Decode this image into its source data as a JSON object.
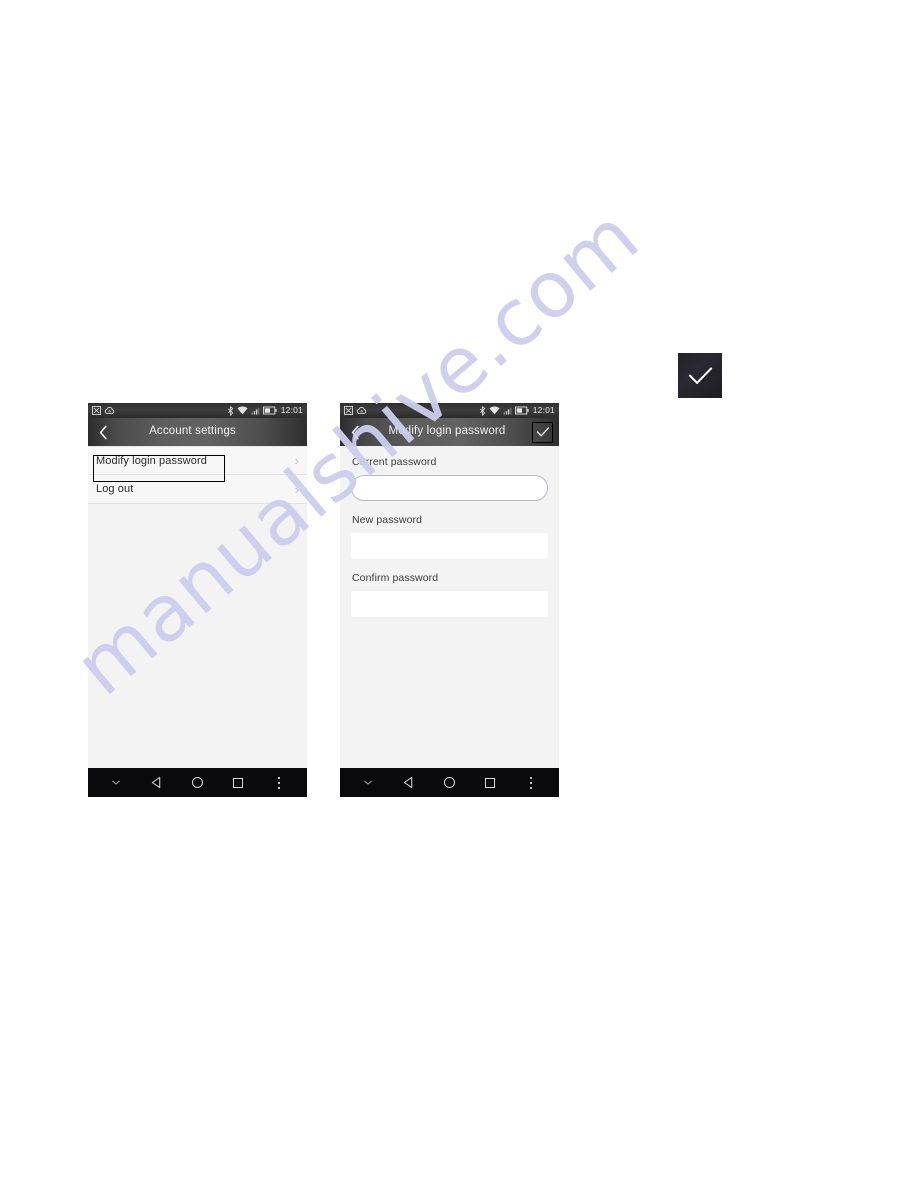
{
  "page": {
    "background_color": "#ffffff",
    "watermark": {
      "text": "manualshive.com",
      "color": "#cdcdee"
    }
  },
  "callout": {
    "name": "confirm-check-callout",
    "icon": "check-icon",
    "background_color": "#26242d",
    "icon_color": "#ffffff"
  },
  "phones": [
    {
      "id": "account-settings",
      "status_bar": {
        "left_icons": [
          "screenshot-icon",
          "cloud-sync-icon"
        ],
        "right_icons": [
          "bluetooth-icon",
          "wifi-icon",
          "signal-icon",
          "battery-icon"
        ],
        "time": "12:01"
      },
      "action_bar": {
        "back_icon": "chevron-left-icon",
        "title": "Account settings",
        "action_icon": null
      },
      "list": [
        {
          "label": "Modify login password",
          "chevron": "chevron-right-icon",
          "annotated": true
        },
        {
          "label": "Log out",
          "chevron": "chevron-right-icon",
          "annotated": false
        }
      ],
      "nav_bar": {
        "buttons": [
          "hide-nav-icon",
          "back-icon",
          "home-icon",
          "recents-icon",
          "overflow-menu-icon"
        ]
      }
    },
    {
      "id": "modify-login-password",
      "status_bar": {
        "left_icons": [
          "screenshot-icon",
          "cloud-sync-icon"
        ],
        "right_icons": [
          "bluetooth-icon",
          "wifi-icon",
          "signal-icon",
          "battery-icon"
        ],
        "time": "12:01"
      },
      "action_bar": {
        "back_icon": "chevron-left-icon",
        "title": "Modify login password",
        "action_icon": "check-icon",
        "action_annotated": true
      },
      "form": {
        "fields": [
          {
            "label": "Current password",
            "value": "",
            "placeholder": "",
            "style": "outlined"
          },
          {
            "label": "New password",
            "value": "",
            "placeholder": "",
            "style": "plain"
          },
          {
            "label": "Confirm password",
            "value": "",
            "placeholder": "",
            "style": "plain"
          }
        ]
      },
      "nav_bar": {
        "buttons": [
          "hide-nav-icon",
          "back-icon",
          "home-icon",
          "recents-icon",
          "overflow-menu-icon"
        ]
      }
    }
  ]
}
